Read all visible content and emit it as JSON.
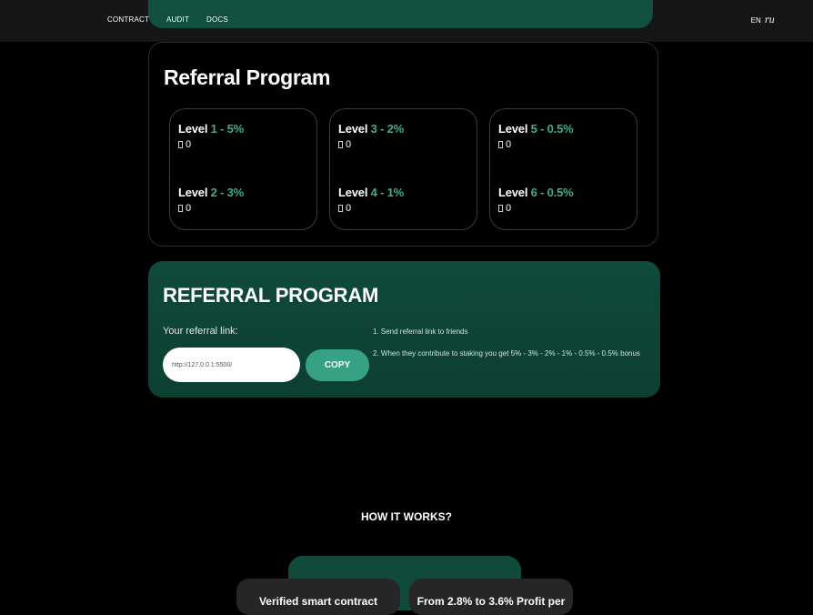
{
  "nav": {
    "items": [
      "CONTRACT",
      "AUDIT",
      "DOCS"
    ],
    "lang_en": "EN",
    "lang_ru": "ru"
  },
  "levels_card": {
    "title": "Referral Program",
    "level_word": "Level",
    "levels": [
      {
        "num": "1",
        "pct": "5%",
        "value": "0"
      },
      {
        "num": "2",
        "pct": "3%",
        "value": "0"
      },
      {
        "num": "3",
        "pct": "2%",
        "value": "0"
      },
      {
        "num": "4",
        "pct": "1%",
        "value": "0"
      },
      {
        "num": "5",
        "pct": "0.5%",
        "value": "0"
      },
      {
        "num": "6",
        "pct": "0.5%",
        "value": "0"
      }
    ]
  },
  "ref_card": {
    "title": "REFERRAL PROGRAM",
    "label": "Your referral link:",
    "link_value": "http://127.0.0.1:5500/",
    "copy_label": "COPY",
    "steps": [
      "1. Send referral link to friends",
      "2. When they contribute to staking you get 5% - 3% - 2% - 1% - 0.5% - 0.5% bonus"
    ]
  },
  "how": {
    "title": "HOW IT WORKS?",
    "features": [
      "Verified smart contract",
      "From 2.8% to 3.6% Profit per"
    ]
  },
  "colors": {
    "accent": "#3fae8a",
    "green_card": "#0f4a3b",
    "button": "#37a183"
  }
}
